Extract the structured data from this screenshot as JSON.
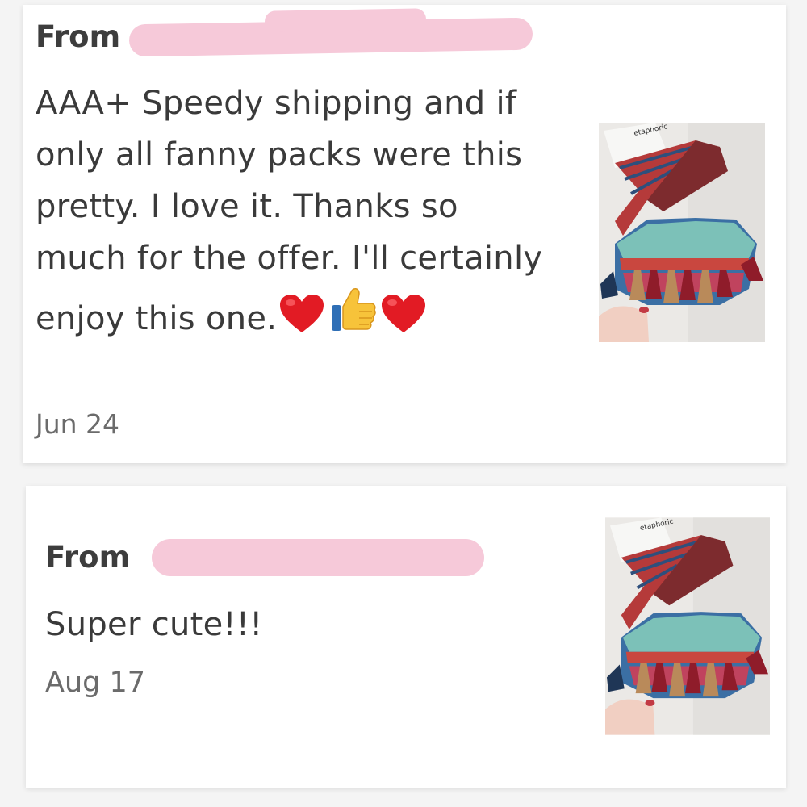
{
  "reviews": [
    {
      "from_label": "From",
      "text": "AAA+ Speedy shipping and if only all fanny packs were this pretty. I love it. Thanks so much for the offer. I'll certainly enjoy this one.",
      "emojis": [
        "red-heart-icon",
        "thumbs-up-icon",
        "red-heart-icon"
      ],
      "date": "Jun 24",
      "image_label": "etaphoric"
    },
    {
      "from_label": "From",
      "text": "Super cute!!!",
      "date": "Aug 17",
      "image_label": "etaphoric"
    }
  ],
  "colors": {
    "redaction": "#f6c9d9",
    "text": "#3a3a3a",
    "date": "#6b6b6b"
  }
}
